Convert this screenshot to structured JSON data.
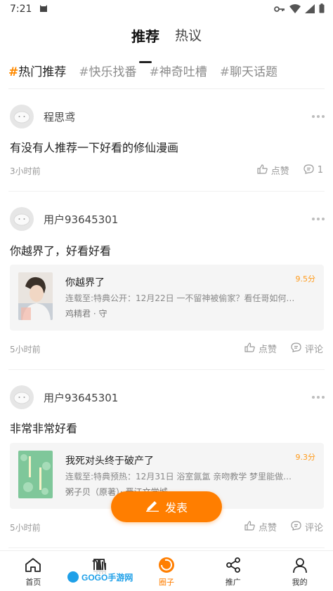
{
  "status_bar": {
    "time": "7:21"
  },
  "top_tabs": [
    {
      "label": "推荐",
      "active": true
    },
    {
      "label": "热议",
      "active": false
    }
  ],
  "sub_tabs": [
    {
      "hash": "#",
      "label": "热门推荐",
      "active": true
    },
    {
      "hash": "#",
      "label": "快乐找番",
      "active": false
    },
    {
      "hash": "#",
      "label": "神奇吐槽",
      "active": false
    },
    {
      "hash": "#",
      "label": "聊天话题",
      "active": false
    }
  ],
  "posts": [
    {
      "username": "程思鸢",
      "text": "有没有人推荐一下好看的修仙漫画",
      "time": "3小时前",
      "like_label": "点赞",
      "comment_label": "1"
    },
    {
      "username": "用户93645301",
      "text": "你越界了，好看好看",
      "time": "5小时前",
      "like_label": "点赞",
      "comment_label": "评论",
      "comic": {
        "title": "你越界了",
        "score": "9.5分",
        "desc": "连载至:特典公开：12月22日 一不留神被偷家？看任哥如何证...",
        "author": "鸡精君 · 守"
      }
    },
    {
      "username": "用户93645301",
      "text": "非常非常好看",
      "time": "5小时前",
      "like_label": "点赞",
      "comment_label": "评论",
      "comic": {
        "title": "我死对头终于破产了",
        "score": "9.3分",
        "desc": "连载至:特典预热：12月31日 浴室氤氲 亲吻教学 梦里能做到...",
        "author": "粥子贝（原著）· 晋江文学城"
      }
    }
  ],
  "fab": {
    "label": "发表"
  },
  "bottom_nav": [
    {
      "label": "首页",
      "icon": "home-icon",
      "active": false
    },
    {
      "label": "",
      "icon": "book-icon",
      "active": false
    },
    {
      "label": "圈子",
      "icon": "circle-icon",
      "active": true
    },
    {
      "label": "推广",
      "icon": "share-icon",
      "active": false
    },
    {
      "label": "我的",
      "icon": "user-icon",
      "active": false
    }
  ],
  "watermark": {
    "text": "GOGO手游网"
  },
  "colors": {
    "accent": "#ff7e00",
    "score": "#ff9a1a"
  }
}
